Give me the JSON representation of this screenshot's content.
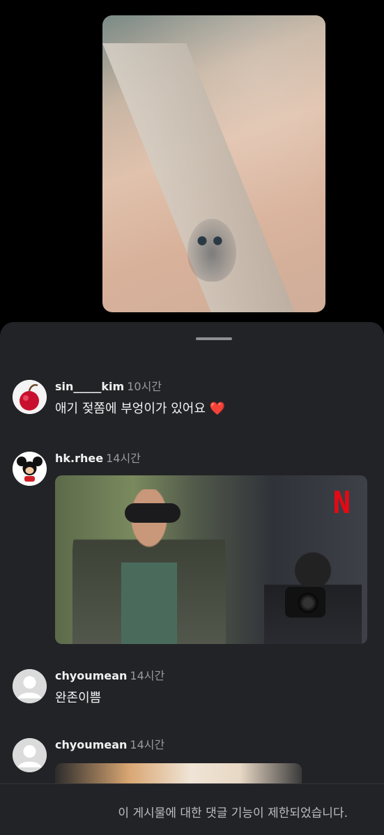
{
  "comments": [
    {
      "username": "sin_____kim",
      "time": "10시간",
      "text": "애기 젖쫌에  부엉이가 있어요",
      "emoji": "❤️"
    },
    {
      "username": "hk.rhee",
      "time": "14시간",
      "media_badge": "N"
    },
    {
      "username": "chyoumean",
      "time": "14시간",
      "text": "완존이쁨"
    },
    {
      "username": "chyoumean",
      "time": "14시간"
    }
  ],
  "footer": {
    "notice": "이 게시물에 대한 댓글 기능이 제한되었습니다."
  },
  "colors": {
    "sheet_bg": "#222327",
    "heart": "#e3312f",
    "netflix_red": "#e50914"
  }
}
